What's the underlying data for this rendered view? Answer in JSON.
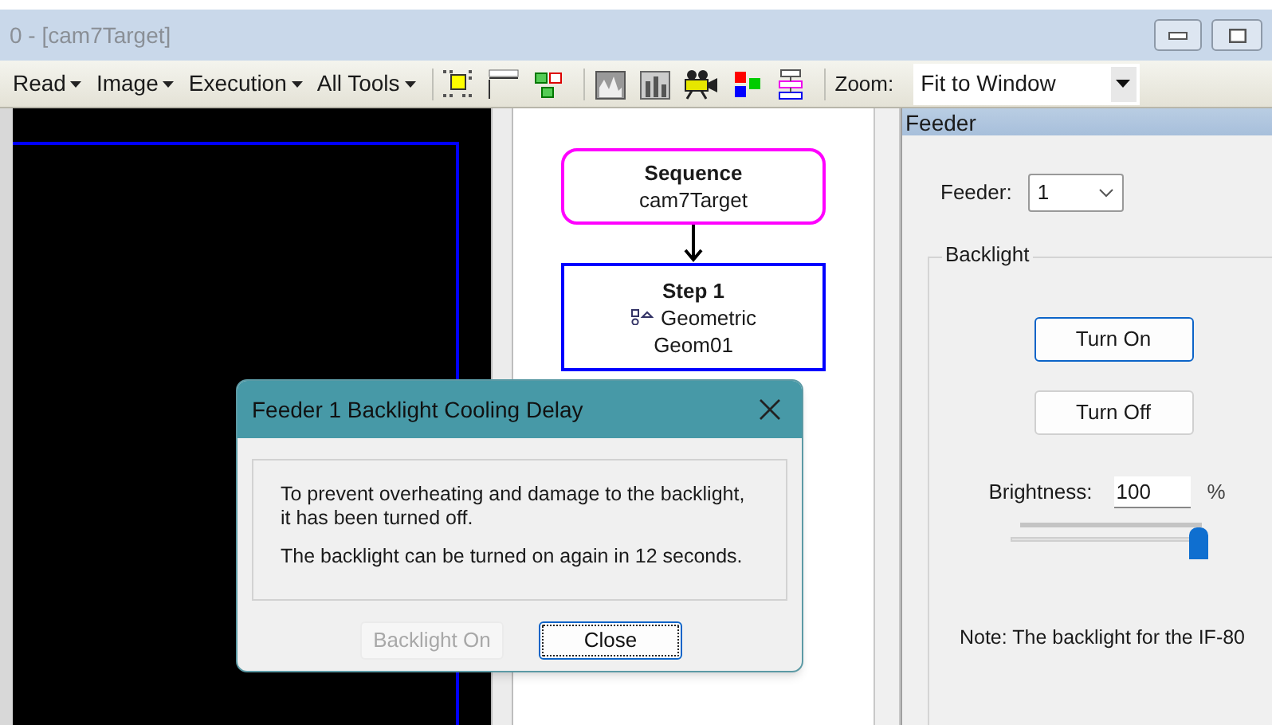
{
  "window": {
    "title": "0 - [cam7Target]"
  },
  "toolbar": {
    "menus": [
      {
        "label": "Read"
      },
      {
        "label": "Image"
      },
      {
        "label": "Execution"
      },
      {
        "label": "All Tools"
      }
    ],
    "zoom_label": "Zoom:",
    "zoom_value": "Fit to Window"
  },
  "flow": {
    "nodes": [
      {
        "kind": "sequence",
        "title": "Sequence",
        "subtitle": "cam7Target"
      },
      {
        "kind": "step",
        "title": "Step 1",
        "tool": "Geometric",
        "subtitle": "Geom01"
      }
    ]
  },
  "feeder_panel": {
    "title": "Feeder",
    "feeder_label": "Feeder:",
    "feeder_value": "1",
    "group_title": "Backlight",
    "buttons": [
      {
        "label": "Turn On",
        "focused": true
      },
      {
        "label": "Turn Off",
        "focused": false
      }
    ],
    "brightness_label": "Brightness:",
    "brightness_value": "100",
    "unit": "%",
    "slider": {
      "level": 1
    },
    "note": "Note: The backlight for the IF-80"
  },
  "dialog": {
    "title": "Feeder 1 Backlight Cooling Delay",
    "messages": [
      "To prevent overheating and damage to the backlight, it has been turned off.",
      "The backlight can be turned on again in 12 seconds."
    ],
    "buttons": [
      {
        "label": "Backlight On",
        "disabled": true,
        "focused": false
      },
      {
        "label": "Close",
        "disabled": false,
        "focused": true
      }
    ]
  }
}
